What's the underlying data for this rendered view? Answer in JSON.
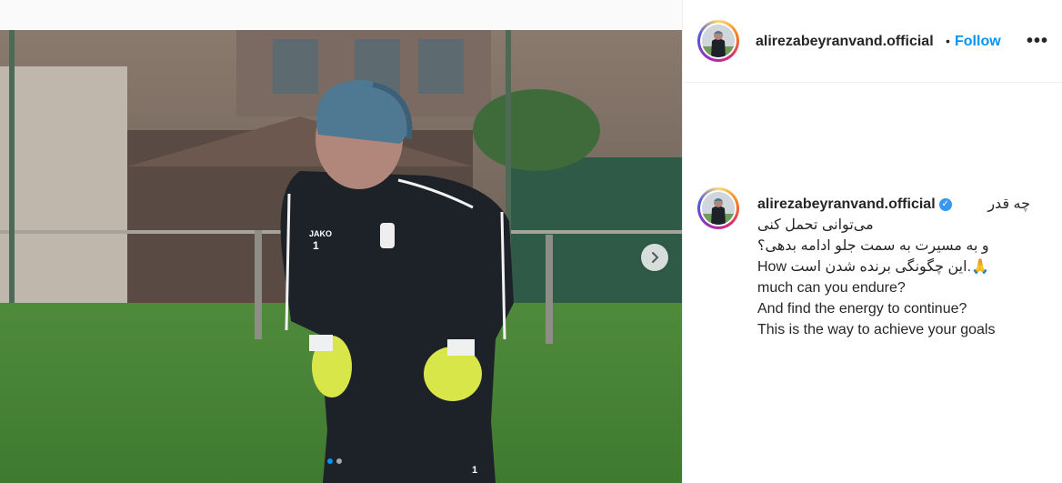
{
  "post": {
    "username": "alirezabeyranvand.official",
    "separator": "•",
    "follow_label": "Follow",
    "more_label": "•••",
    "avatar_alt": "profile picture"
  },
  "caption": {
    "username": "alirezabeyranvand.official",
    "verified_icon": "verified-badge-icon",
    "lines": [
      "چه قدر",
      "می‌توانی تحمل کنی",
      "و به مسیرت به سمت جلو ادامه بدهی؟",
      "🙏.این چگونگی برنده شدن است How",
      "much can you endure?",
      "And find the energy to continue?",
      "This is the way to achieve your goals"
    ]
  },
  "carousel": {
    "next_icon": "chevron-right-icon",
    "current_slide": 1,
    "total_slides": 2
  },
  "colors": {
    "accent": "#0095f6",
    "text": "#262626",
    "verified": "#3897f0"
  }
}
